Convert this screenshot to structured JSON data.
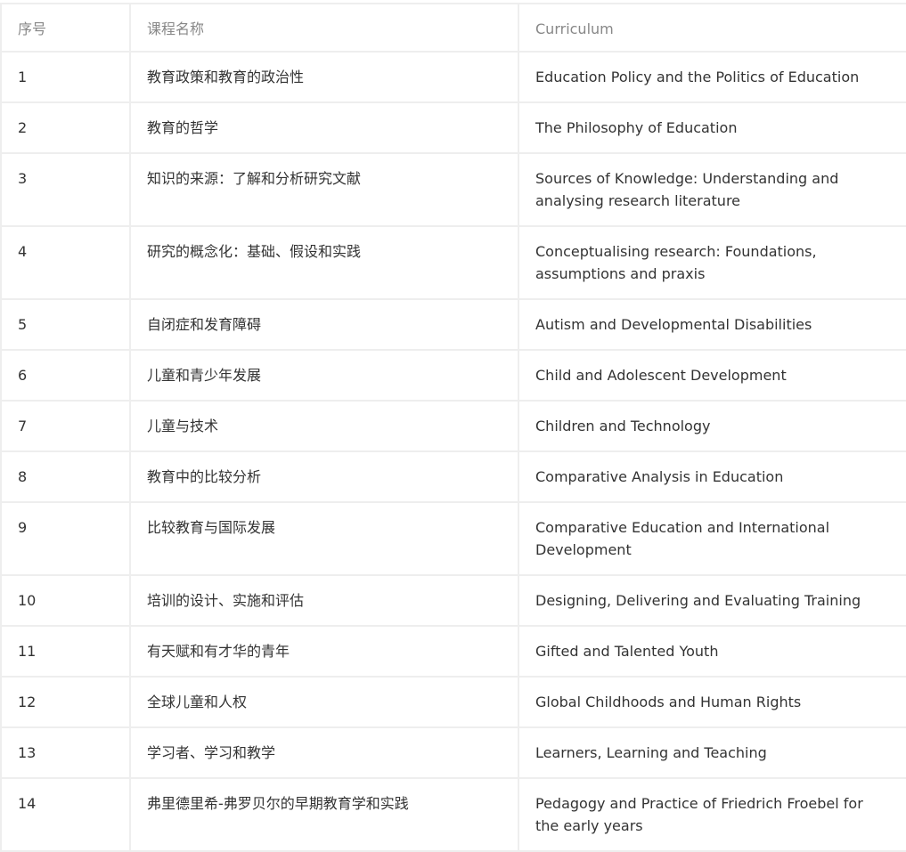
{
  "table": {
    "headers": {
      "index": "序号",
      "course_name": "课程名称",
      "curriculum": "Curriculum"
    },
    "rows": [
      {
        "index": "1",
        "cn": "教育政策和教育的政治性",
        "en": "Education Policy and the Politics of Education"
      },
      {
        "index": "2",
        "cn": "教育的哲学",
        "en": "The Philosophy of Education"
      },
      {
        "index": "3",
        "cn": "知识的来源：了解和分析研究文献",
        "en": "Sources of Knowledge: Understanding and analysing research literature"
      },
      {
        "index": "4",
        "cn": "研究的概念化：基础、假设和实践",
        "en": "Conceptualising research: Foundations, assumptions and praxis"
      },
      {
        "index": "5",
        "cn": "自闭症和发育障碍",
        "en": "Autism and Developmental Disabilities"
      },
      {
        "index": "6",
        "cn": "儿童和青少年发展",
        "en": "Child and Adolescent Development"
      },
      {
        "index": "7",
        "cn": "儿童与技术",
        "en": "Children and Technology"
      },
      {
        "index": "8",
        "cn": "教育中的比较分析",
        "en": "Comparative Analysis in Education"
      },
      {
        "index": "9",
        "cn": "比较教育与国际发展",
        "en": "Comparative Education and International Development"
      },
      {
        "index": "10",
        "cn": "培训的设计、实施和评估",
        "en": "Designing, Delivering and Evaluating Training"
      },
      {
        "index": "11",
        "cn": "有天赋和有才华的青年",
        "en": "Gifted and Talented Youth"
      },
      {
        "index": "12",
        "cn": "全球儿童和人权",
        "en": "Global Childhoods and Human Rights"
      },
      {
        "index": "13",
        "cn": "学习者、学习和教学",
        "en": "Learners, Learning and Teaching"
      },
      {
        "index": "14",
        "cn": "弗里德里希-弗罗贝尔的早期教育学和实践",
        "en": "Pedagogy and Practice of Friedrich Froebel for the early years"
      }
    ]
  }
}
